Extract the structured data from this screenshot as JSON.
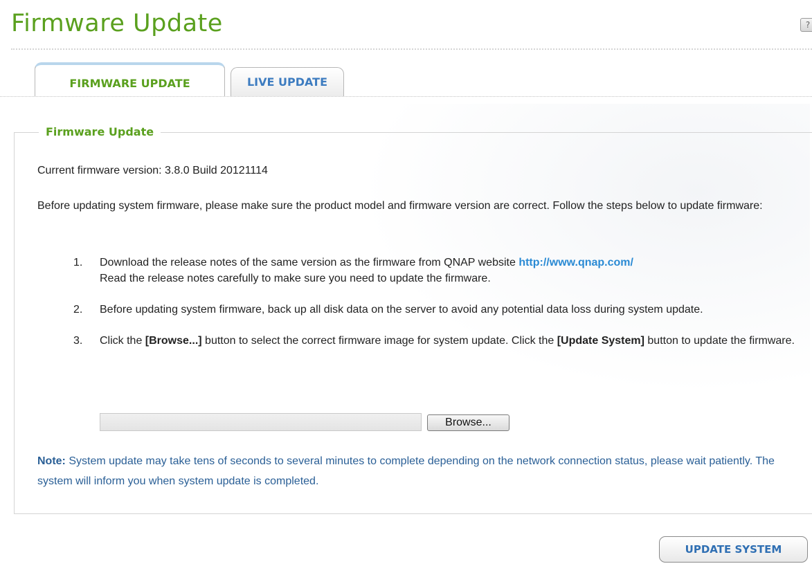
{
  "page": {
    "title": "Firmware Update",
    "help_icon": "?"
  },
  "tabs": [
    {
      "label": "FIRMWARE UPDATE",
      "active": true
    },
    {
      "label": "LIVE UPDATE",
      "active": false
    }
  ],
  "section": {
    "legend": "Firmware Update",
    "current_version": "Current firmware version: 3.8.0 Build 20121114",
    "intro": "Before updating system firmware, please make sure the product model and firmware version are correct. Follow the steps below to update firmware:",
    "steps": [
      {
        "number": "1.",
        "text_a": "Download the release notes of the same version as the firmware from QNAP website ",
        "link": "http://www.qnap.com/",
        "text_b": "Read the release notes carefully to make sure you need to update the firmware."
      },
      {
        "number": "2.",
        "text": "Before updating system firmware, back up all disk data on the server to avoid any potential data loss during system update."
      },
      {
        "number": "3.",
        "text_a": "Click the ",
        "bold_a": "[Browse...]",
        "text_b": " button to select the correct firmware image for system update. Click the ",
        "bold_b": "[Update System]",
        "text_c": " button to update the firmware."
      }
    ],
    "file_input_value": "",
    "browse_label": "Browse...",
    "note_label": "Note:",
    "note_text": " System update may take tens of seconds to several minutes to complete depending on the network connection status, please wait patiently. The system will inform you when system update is completed."
  },
  "actions": {
    "update_label": "UPDATE SYSTEM"
  },
  "colors": {
    "accent_green": "#5aa01e",
    "link_blue": "#2a8ad4",
    "note_blue": "#2a5f96"
  }
}
